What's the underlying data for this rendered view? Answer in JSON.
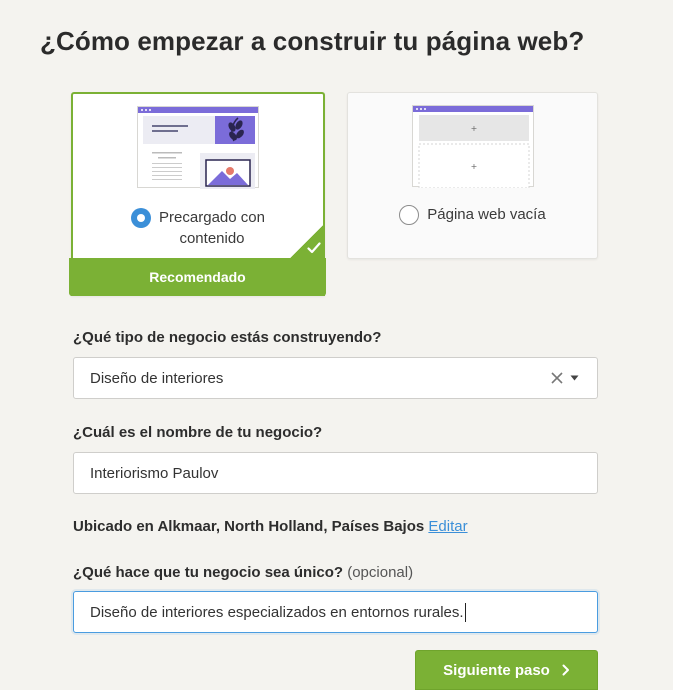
{
  "page_title": "¿Cómo empezar a construir tu página web?",
  "options": {
    "preloaded": {
      "label_line1": "Precargado con",
      "label_line2": "contenido",
      "selected": true,
      "badge": "Recomendado"
    },
    "empty": {
      "label": "Página web vacía",
      "selected": false
    }
  },
  "form": {
    "business_type": {
      "label": "¿Qué tipo de negocio estás construyendo?",
      "value": "Diseño de interiores"
    },
    "business_name": {
      "label": "¿Cuál es el nombre de tu negocio?",
      "value": "Interiorismo Paulov"
    },
    "location": {
      "text": "Ubicado en Alkmaar, North Holland, Países Bajos",
      "edit_link": "Editar"
    },
    "unique": {
      "label": "¿Qué hace que tu negocio sea único?",
      "optional": "(opcional)",
      "value": "Diseño de interiores especializados en entornos rurales."
    }
  },
  "next_button": {
    "label": "Siguiente paso"
  },
  "colors": {
    "accent_green": "#7bb135",
    "accent_blue": "#3b8fd8",
    "thumb_purple": "#7b6cd9"
  }
}
